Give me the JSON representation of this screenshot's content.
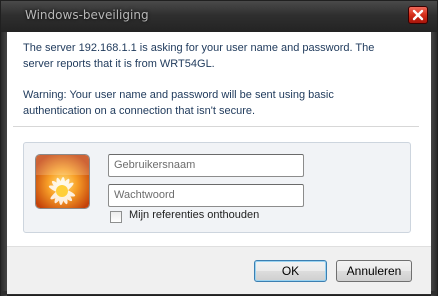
{
  "window": {
    "title": "Windows-beveiliging"
  },
  "dialog": {
    "message_lines": [
      "The server 192.168.1.1 is asking for your user name and password. The",
      "server reports that it is from WRT54GL."
    ],
    "warning_lines": [
      "Warning: Your user name and password will be sent using basic",
      "authentication on a connection that isn't secure."
    ],
    "username_placeholder": "Gebruikersnaam",
    "password_placeholder": "Wachtwoord",
    "remember_label": "Mijn referenties onthouden",
    "remember_checked": false
  },
  "buttons": {
    "ok": "OK",
    "cancel": "Annuleren"
  },
  "colors": {
    "message_text": "#1e395b",
    "close_button": "#d52d19",
    "credential_panel": "#f1f3f6"
  },
  "icons": {
    "close": "close-x-icon",
    "user_tile": "orange-flower-user-tile"
  }
}
